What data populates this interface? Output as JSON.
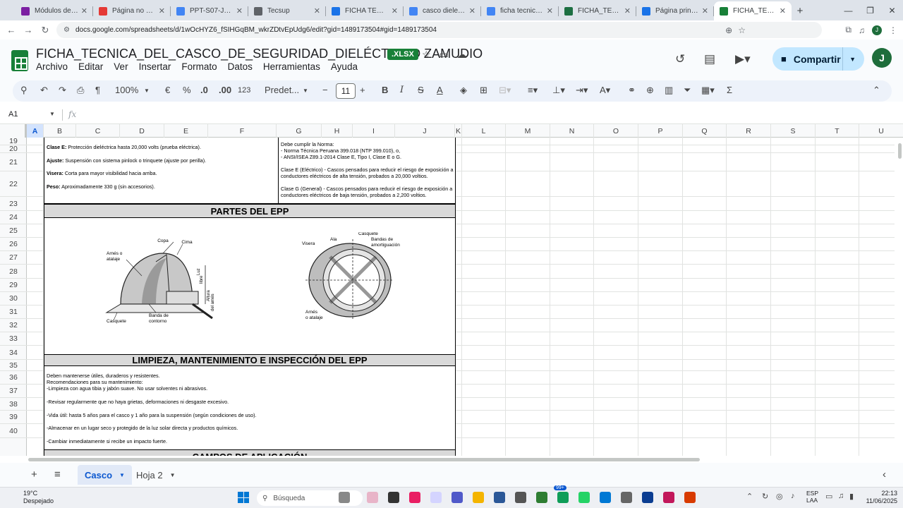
{
  "browser": {
    "tabs": [
      {
        "title": "Módulos del curso",
        "color": "#7b1fa2"
      },
      {
        "title": "Página no encontrada",
        "color": "#e53935"
      },
      {
        "title": "PPT-S07-JQUISPE",
        "color": "#4285f4"
      },
      {
        "title": "Tecsup",
        "color": "#5f6368"
      },
      {
        "title": "FICHA TECNICA_2",
        "color": "#1a73e8"
      },
      {
        "title": "casco dielectrico",
        "color": "#4285f4"
      },
      {
        "title": "ficha tecnica del c",
        "color": "#4285f4"
      },
      {
        "title": "FICHA_TECNICA_",
        "color": "#1d6f42"
      },
      {
        "title": "Página principal",
        "color": "#1a73e8"
      },
      {
        "title": "FICHA_TECNICA_",
        "color": "#188038"
      }
    ],
    "url": "docs.google.com/spreadsheets/d/1wOcHYZ6_fSIHGqBM_wkrZDtvEpUdg6/edit?gid=1489173504#gid=1489173504"
  },
  "doc": {
    "title": "FICHA_TECNICA_DEL_CASCO_DE_SEGURIDAD_DIELÉCTRICO ZAMUDIO",
    "badge": ".XLSX",
    "menu": [
      "Archivo",
      "Editar",
      "Ver",
      "Insertar",
      "Formato",
      "Datos",
      "Herramientas",
      "Ayuda"
    ],
    "share_label": "Compartir",
    "avatar_letter": "J"
  },
  "toolbar": {
    "zoom": "100%",
    "currency": "€",
    "percent": "%",
    "dec_less": ".0",
    "dec_more": ".00",
    "num_format": "123",
    "font": "Predet...",
    "font_size": "11"
  },
  "formula": {
    "cell": "A1",
    "fx": "fx"
  },
  "columns": [
    "A",
    "B",
    "C",
    "D",
    "E",
    "F",
    "G",
    "H",
    "I",
    "J",
    "K",
    "L",
    "M",
    "N",
    "O",
    "P",
    "Q",
    "R",
    "S",
    "T",
    "U"
  ],
  "rows": [
    "19",
    "20",
    "21",
    "22",
    "23",
    "24",
    "25",
    "26",
    "27",
    "28",
    "29",
    "30",
    "31",
    "32",
    "33",
    "34",
    "35",
    "36",
    "37",
    "38",
    "39",
    "40"
  ],
  "content": {
    "specs": [
      {
        "label": "Clase E:",
        "text": " Protección dieléctrica hasta 20,000 volts (prueba eléctrica)."
      },
      {
        "label": "Ajuste:",
        "text": " Suspensión con sistema pinlock o trinquete (ajuste por perilla)."
      },
      {
        "label": "Visera:",
        "text": " Corta para mayor visibilidad hacia arriba."
      },
      {
        "label": "Peso:",
        "text": " Aproximadamente 330 g (sin accesorios)."
      }
    ],
    "norma": [
      "Debe cumplir la Norma:",
      "- Norma Técnica Peruana 399.018 (NTP 399.010), o,",
      "- ANSI/ISEA Z89.1-2014 Clase E, Tipo I, Clase E o G.",
      "Clase E (Eléctrico) - Cascos pensados para reducir el riesgo de exposición a",
      "conductores eléctricos de alta tensión, probados a 20,000 voltios.",
      "Clase G (General) - Cascos pensados para reducir el riesgo de exposición a",
      "conductores eléctricos de baja tensión, probados a 2,200 voltios."
    ],
    "parts_title": "PARTES DEL EPP",
    "diagram1": [
      "Copa",
      "Cima",
      "Arnés o",
      "atalaje",
      "Luz",
      "libre",
      "Altura",
      "del arnés",
      "Banda de",
      "contorno",
      "Casquete"
    ],
    "diagram2": [
      "Casquete",
      "Bandas de",
      "amortiguación",
      "Visera",
      "Ala",
      "Arnés",
      "o atalaje"
    ],
    "cleaning_title": "LIMPIEZA, MANTENIMIENTO E INSPECCIÓN DEL EPP",
    "cleaning": [
      "Deben mantenerse útiles, duraderos y resistentes.",
      "Recomendaciones para su mantenimiento:",
      "-Limpieza con agua tibia y jabón suave. No usar solventes ni abrasivos.",
      "-Revisar regularmente que no haya grietas, deformaciones ni desgaste excesivo.",
      "-Vida útil: hasta 5 años para el casco y 1 año para la suspensión (según condiciones de uso).",
      "-Almacenar en un lugar seco y protegido de la luz solar directa y productos químicos.",
      "-Cambiar inmediatamente si recibe un impacto fuerte."
    ],
    "next_title": "CAMPOS DE APLICACIÓN"
  },
  "sheets": {
    "active": "Casco",
    "other": "Hoja 2"
  },
  "taskbar": {
    "temp": "19°C",
    "weather": "Despejado",
    "search": "Búsqueda",
    "lang1": "ESP",
    "lang2": "LAA",
    "time": "22:13",
    "date": "11/06/2025",
    "badge": "99+"
  }
}
